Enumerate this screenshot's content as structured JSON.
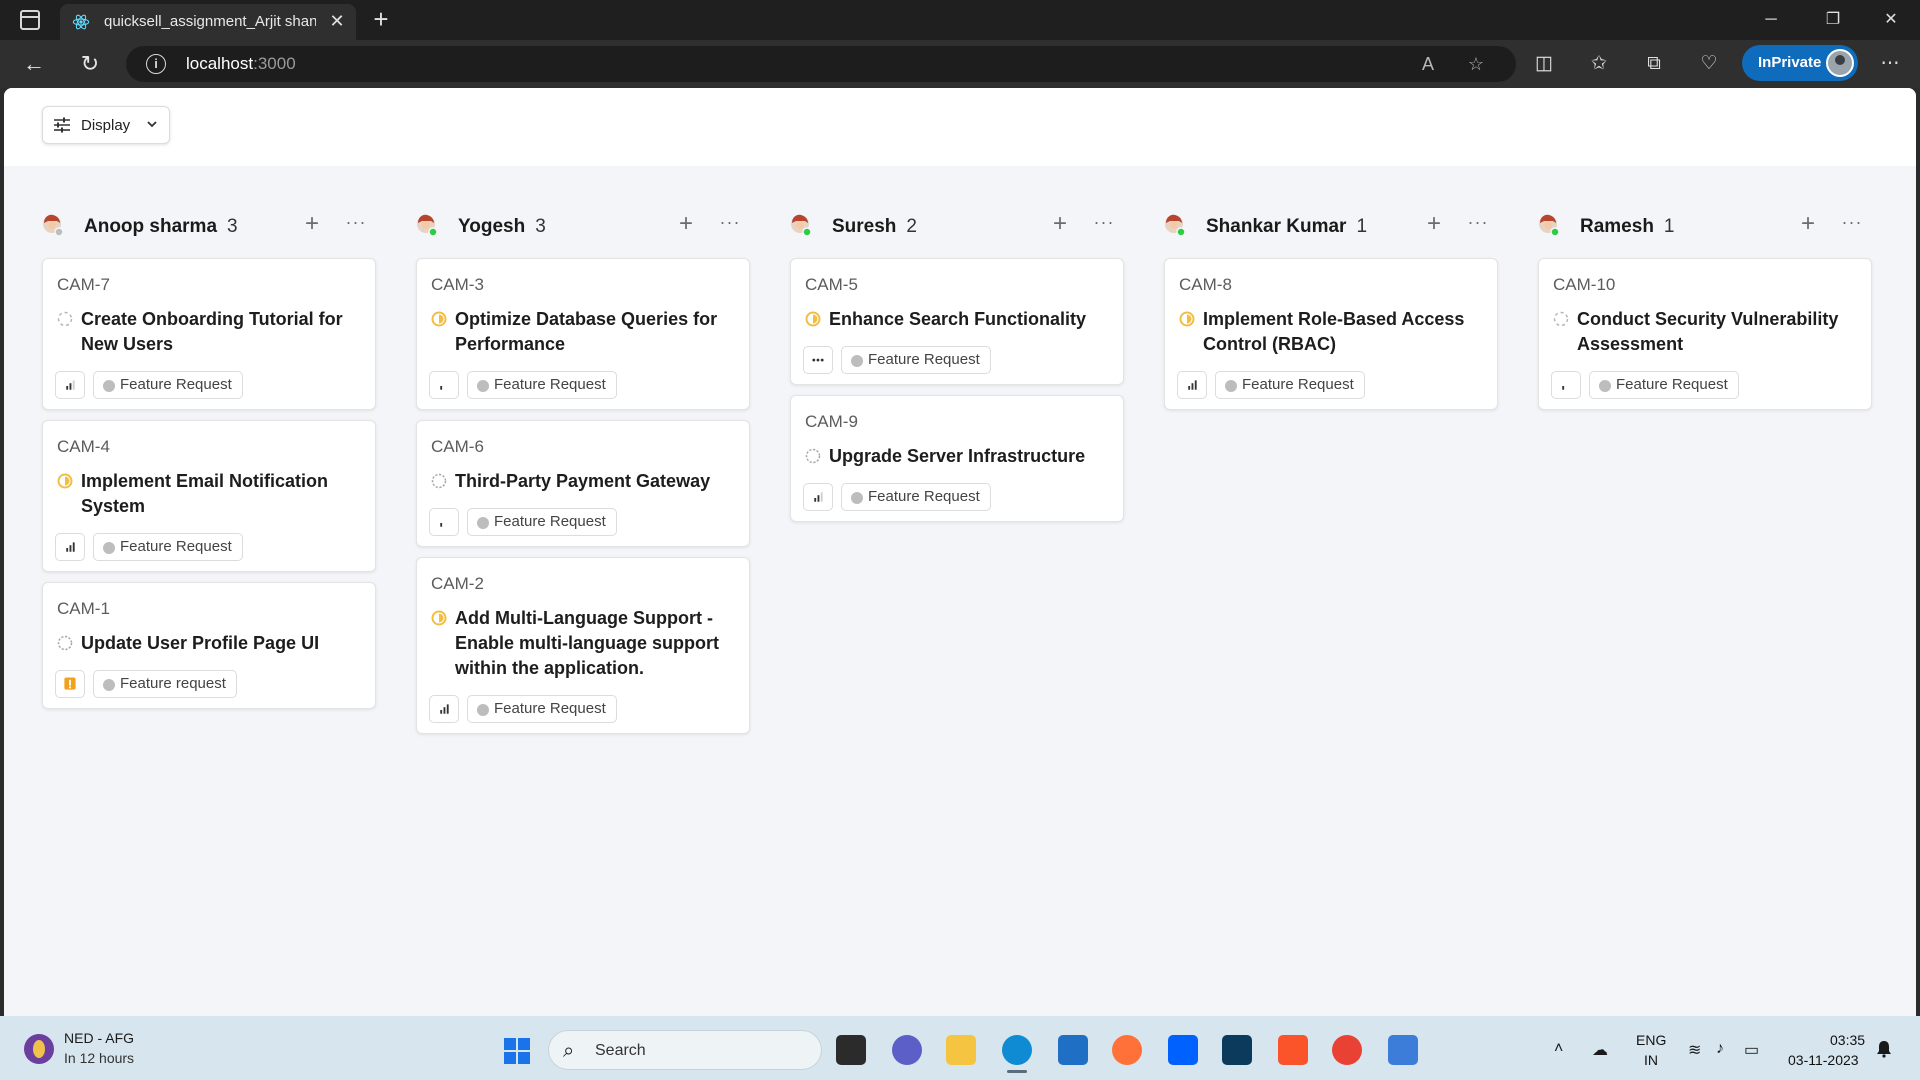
{
  "browser": {
    "tab_title": "quicksell_assignment_Arjit shand",
    "url_host": "localhost",
    "url_port": ":3000",
    "inprivate_label": "InPrivate"
  },
  "toolbar": {
    "display_label": "Display"
  },
  "columns": [
    {
      "name": "Anoop sharma",
      "count": "3",
      "online": false,
      "cards": [
        {
          "id": "CAM-7",
          "title": "Create Onboarding Tutorial for New Users",
          "status": "backlog",
          "priority": "low",
          "tag": "Feature Request"
        },
        {
          "id": "CAM-4",
          "title": "Implement Email Notification System",
          "status": "in-progress",
          "priority": "high",
          "tag": "Feature Request"
        },
        {
          "id": "CAM-1",
          "title": "Update User Profile Page UI",
          "status": "todo",
          "priority": "urgent",
          "tag": "Feature request"
        }
      ]
    },
    {
      "name": "Yogesh",
      "count": "3",
      "online": true,
      "cards": [
        {
          "id": "CAM-3",
          "title": "Optimize Database Queries for Performance",
          "status": "in-progress",
          "priority": "low-single",
          "tag": "Feature Request"
        },
        {
          "id": "CAM-6",
          "title": "Third-Party Payment Gateway",
          "status": "todo",
          "priority": "low-single",
          "tag": "Feature Request"
        },
        {
          "id": "CAM-2",
          "title": "Add Multi-Language Support - Enable multi-language support within the application.",
          "status": "in-progress",
          "priority": "high",
          "tag": "Feature Request"
        }
      ]
    },
    {
      "name": "Suresh",
      "count": "2",
      "online": true,
      "cards": [
        {
          "id": "CAM-5",
          "title": "Enhance Search Functionality",
          "status": "in-progress",
          "priority": "none",
          "tag": "Feature Request"
        },
        {
          "id": "CAM-9",
          "title": "Upgrade Server Infrastructure",
          "status": "todo",
          "priority": "low",
          "tag": "Feature Request"
        }
      ]
    },
    {
      "name": "Shankar Kumar",
      "count": "1",
      "online": true,
      "cards": [
        {
          "id": "CAM-8",
          "title": "Implement Role-Based Access Control (RBAC)",
          "status": "in-progress",
          "priority": "high",
          "tag": "Feature Request"
        }
      ]
    },
    {
      "name": "Ramesh",
      "count": "1",
      "online": true,
      "cards": [
        {
          "id": "CAM-10",
          "title": "Conduct Security Vulnerability Assessment",
          "status": "backlog",
          "priority": "low-single",
          "tag": "Feature Request"
        }
      ]
    }
  ],
  "taskbar": {
    "weather_title": "NED - AFG",
    "weather_sub": "In 12 hours",
    "search_label": "Search",
    "lang_line1": "ENG",
    "lang_line2": "IN",
    "time": "03:35",
    "date": "03-11-2023"
  },
  "colors": {
    "in_progress": "#f2be42",
    "online": "#2ecc40",
    "accent": "#0f6cbd"
  }
}
